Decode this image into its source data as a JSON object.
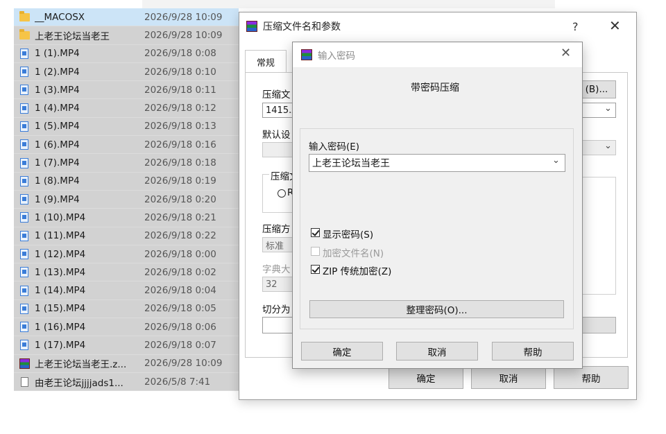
{
  "explorer": {
    "files": [
      {
        "name": "__MACOSX",
        "date": "2026/9/28 10:09",
        "icon": "folder-icon",
        "selected": true
      },
      {
        "name": "上老王论坛当老王",
        "date": "2026/9/28 10:09",
        "icon": "folder-icon",
        "selected": false
      },
      {
        "name": "1 (1).MP4",
        "date": "2026/9/18 0:08",
        "icon": "video-file-icon",
        "selected": false
      },
      {
        "name": "1 (2).MP4",
        "date": "2026/9/18 0:10",
        "icon": "video-file-icon",
        "selected": false
      },
      {
        "name": "1 (3).MP4",
        "date": "2026/9/18 0:11",
        "icon": "video-file-icon",
        "selected": false
      },
      {
        "name": "1 (4).MP4",
        "date": "2026/9/18 0:12",
        "icon": "video-file-icon",
        "selected": false
      },
      {
        "name": "1 (5).MP4",
        "date": "2026/9/18 0:13",
        "icon": "video-file-icon",
        "selected": false
      },
      {
        "name": "1 (6).MP4",
        "date": "2026/9/18 0:16",
        "icon": "video-file-icon",
        "selected": false
      },
      {
        "name": "1 (7).MP4",
        "date": "2026/9/18 0:18",
        "icon": "video-file-icon",
        "selected": false
      },
      {
        "name": "1 (8).MP4",
        "date": "2026/9/18 0:19",
        "icon": "video-file-icon",
        "selected": false
      },
      {
        "name": "1 (9).MP4",
        "date": "2026/9/18 0:20",
        "icon": "video-file-icon",
        "selected": false
      },
      {
        "name": "1 (10).MP4",
        "date": "2026/9/18 0:21",
        "icon": "video-file-icon",
        "selected": false
      },
      {
        "name": "1 (11).MP4",
        "date": "2026/9/18 0:22",
        "icon": "video-file-icon",
        "selected": false
      },
      {
        "name": "1 (12).MP4",
        "date": "2026/9/18 0:00",
        "icon": "video-file-icon",
        "selected": false
      },
      {
        "name": "1 (13).MP4",
        "date": "2026/9/18 0:02",
        "icon": "video-file-icon",
        "selected": false
      },
      {
        "name": "1 (14).MP4",
        "date": "2026/9/18 0:04",
        "icon": "video-file-icon",
        "selected": false
      },
      {
        "name": "1 (15).MP4",
        "date": "2026/9/18 0:05",
        "icon": "video-file-icon",
        "selected": false
      },
      {
        "name": "1 (16).MP4",
        "date": "2026/9/18 0:06",
        "icon": "video-file-icon",
        "selected": false
      },
      {
        "name": "1 (17).MP4",
        "date": "2026/9/18 0:07",
        "icon": "video-file-icon",
        "selected": false
      },
      {
        "name": "上老王论坛当老王.z...",
        "date": "2026/9/28 10:09",
        "icon": "winrar-archive-icon",
        "selected": false
      },
      {
        "name": "由老王论坛jjjjads1...",
        "date": "2026/5/8 7:41",
        "icon": "text-file-icon",
        "selected": false
      }
    ]
  },
  "archive_dialog": {
    "title": "压缩文件名和参数",
    "help_glyph": "?",
    "close_glyph": "✕",
    "tab_general": "常规",
    "archive_name_label": "压缩文",
    "archive_name_value": "1415.z",
    "browse_button": "(B)...",
    "default_profile_label": "默认设",
    "format_group_label": "压缩文",
    "format_radio_letter": "R",
    "method_label": "压缩方",
    "method_value": "标准",
    "dict_label": "字典大",
    "dict_value": "32",
    "split_label": "切分为",
    "ok_button": "确定",
    "cancel_button": "取消",
    "help_button": "帮助"
  },
  "password_dialog": {
    "title": "输入密码",
    "close_glyph": "✕",
    "heading": "带密码压缩",
    "password_label": "输入密码(E)",
    "password_value": "上老王论坛当老王",
    "show_password_label": "显示密码(S)",
    "show_password_checked": true,
    "encrypt_names_label": "加密文件名(N)",
    "encrypt_names_checked": false,
    "zip_legacy_label": "ZIP 传统加密(Z)",
    "zip_legacy_checked": true,
    "organize_button": "整理密码(O)...",
    "ok_button": "确定",
    "cancel_button": "取消",
    "help_button": "帮助"
  }
}
